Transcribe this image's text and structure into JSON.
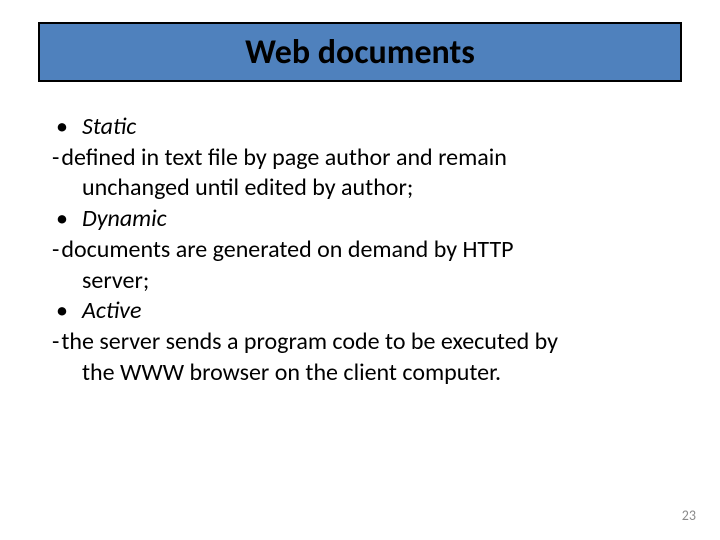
{
  "title": "Web documents",
  "items": [
    {
      "label": "Static",
      "desc_line1": "defined in text file by page author and remain",
      "desc_line2": "unchanged until edited by author;"
    },
    {
      "label": "Dynamic",
      "desc_line1": "documents are generated on demand by HTTP",
      "desc_line2": "server;"
    },
    {
      "label": "Active",
      "desc_line1": "the server sends a program code to be executed by",
      "desc_line2": "the WWW browser on the client computer."
    }
  ],
  "bullet_glyph": "•",
  "dash_a": "- ",
  "dash_b": " -  ",
  "page_number": "23"
}
